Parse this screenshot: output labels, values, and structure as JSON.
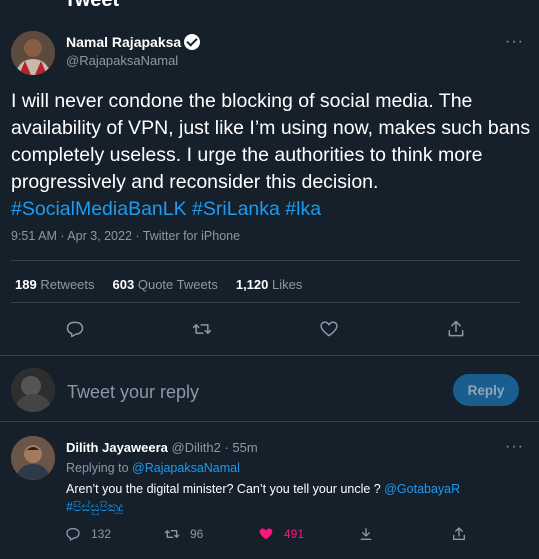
{
  "page": {
    "title": "Tweet"
  },
  "tweet": {
    "author_name": "Namal Rajapaksa",
    "author_handle": "@RajapaksaNamal",
    "text": "I will never condone the blocking of social media. The availability of VPN, just like I’m using now, makes such bans completely useless. I urge the authorities to think more progressively and reconsider this decision.",
    "hashtags": [
      "#SocialMediaBanLK",
      "#SriLanka",
      "#lka"
    ],
    "meta": "9:51 AM · Apr 3, 2022 · Twitter for iPhone",
    "stats": {
      "retweets_count": "189",
      "retweets_label": "Retweets",
      "quotes_count": "603",
      "quotes_label": "Quote Tweets",
      "likes_count": "1,120",
      "likes_label": "Likes"
    }
  },
  "reply_box": {
    "placeholder": "Tweet your reply",
    "button_label": "Reply"
  },
  "reply": {
    "author_name": "Dilith Jayaweera",
    "author_handle": "@Dilith2",
    "time": "· 55m",
    "replying_prefix": "Replying to",
    "replying_to": "@RajapaksaNamal",
    "text": "Aren’t you the digital minister? Can’t you tell your uncle ?",
    "mention": "@GotabayaR",
    "hashtag": "#පිස්සුපිකුදු",
    "reply_count": "132",
    "retweet_count": "96",
    "like_count": "491"
  },
  "colors": {
    "background": "#15202b",
    "accent": "#1d9bf0",
    "muted": "#8b98a5",
    "like": "#f91880",
    "divider": "#38444d"
  }
}
